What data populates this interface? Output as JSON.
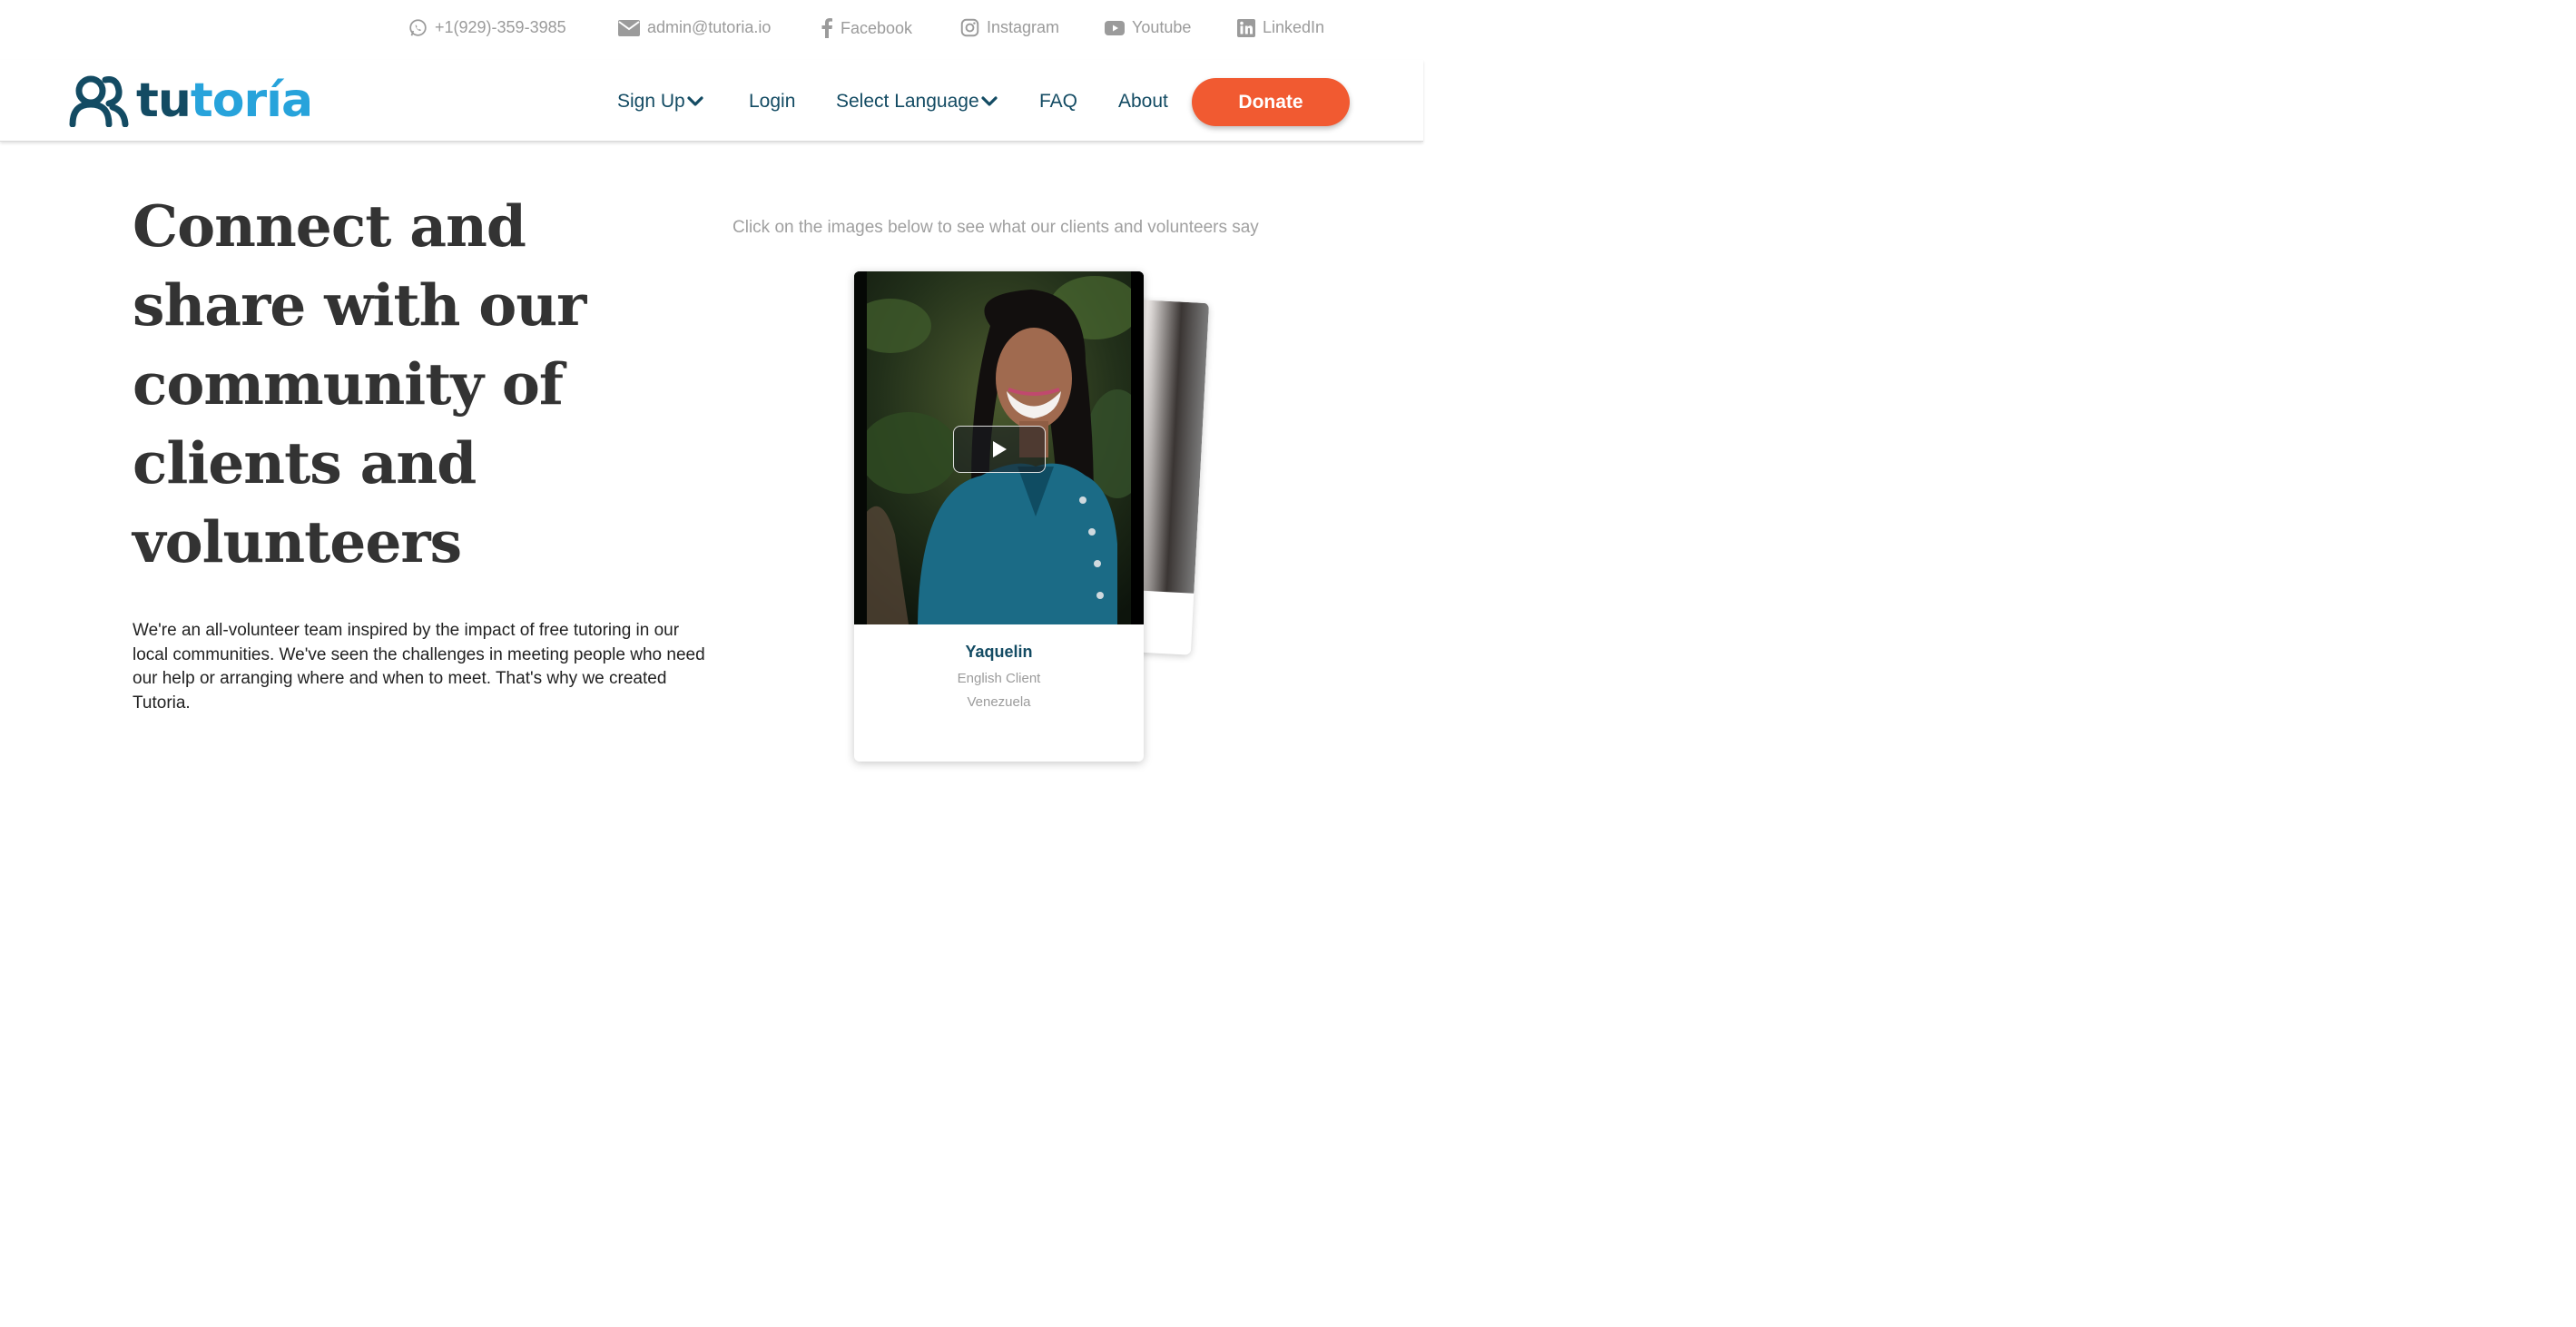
{
  "contacts": {
    "phone": "+1(929)-359-3985",
    "email": "admin@tutoria.io",
    "facebook": "Facebook",
    "instagram": "Instagram",
    "youtube": "Youtube",
    "linkedin": "LinkedIn"
  },
  "logo": {
    "part1": "tu",
    "part2": "toría"
  },
  "nav": {
    "signup": "Sign Up",
    "login": "Login",
    "language": "Select Language",
    "faq": "FAQ",
    "about": "About",
    "donate": "Donate"
  },
  "hero": {
    "headline": "Connect and share with our community of clients and volunteers",
    "intro": "We're an all-volunteer team inspired by the impact of free tutoring in our local communities. We've seen the challenges in meeting people who need our help or arranging where and when to meet. That's why we created Tutoria."
  },
  "testimonials": {
    "caption": "Click on the images below to see what our clients and volunteers say",
    "featured": {
      "name": "Yaquelin",
      "role": "English Client",
      "country": "Venezuela"
    }
  },
  "colors": {
    "brand_dark": "#134b63",
    "brand_light": "#27a3db",
    "donate": "#f15a31",
    "muted": "#9b9b9b"
  },
  "icons": [
    "whatsapp-icon",
    "mail-icon",
    "facebook-icon",
    "instagram-icon",
    "youtube-icon",
    "linkedin-icon",
    "chevron-down-icon",
    "play-icon"
  ]
}
